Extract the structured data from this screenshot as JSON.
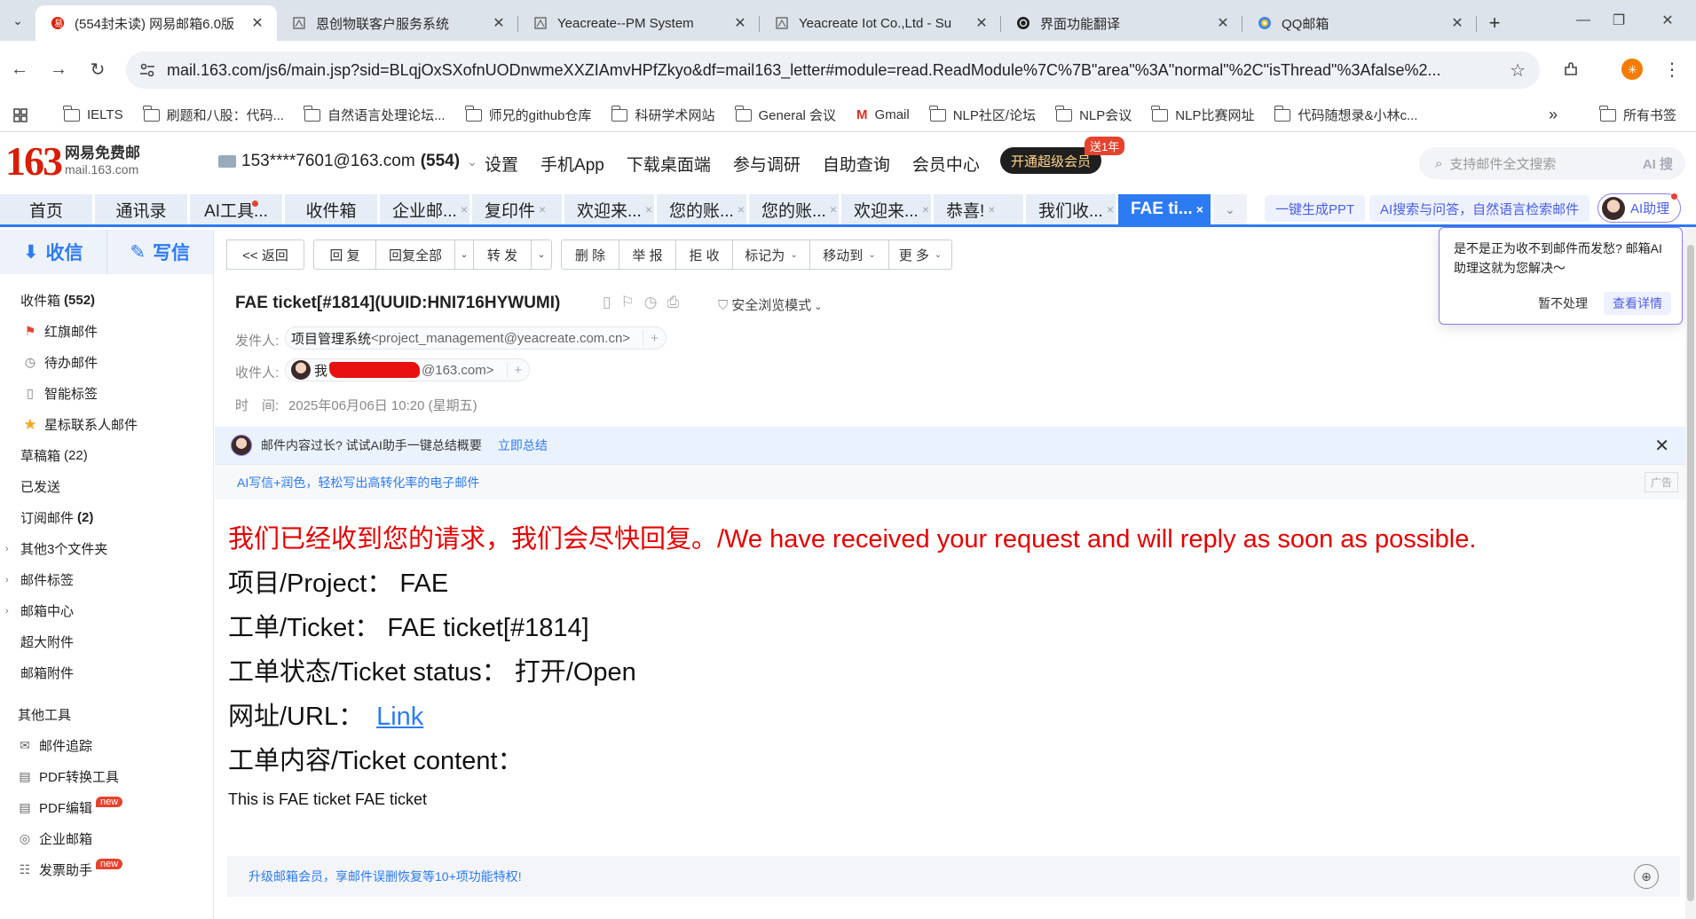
{
  "browser": {
    "tabs": [
      {
        "title": "(554封未读) 网易邮箱6.0版",
        "icon": "netease-mail-icon",
        "active": true
      },
      {
        "title": "恩创物联客户服务系统",
        "icon": "page-icon",
        "active": false
      },
      {
        "title": "Yeacreate--PM System",
        "icon": "page-icon",
        "active": false
      },
      {
        "title": "Yeacreate Iot Co.,Ltd - Su",
        "icon": "page-icon",
        "active": false
      },
      {
        "title": "界面功能翻译",
        "icon": "openai-icon",
        "active": false
      },
      {
        "title": "QQ邮箱",
        "icon": "qq-mail-icon",
        "active": false
      }
    ],
    "url": "mail.163.com/js6/main.jsp?sid=BLqjOxSXofnUODnwmeXXZIAmvHPfZkyo&df=mail163_letter#module=read.ReadModule%7C%7B\"area\"%3A\"normal\"%2C\"isThread\"%3Afalse%2...",
    "bookmarks": [
      "IELTS",
      "刷题和八股：代码...",
      "自然语言处理论坛...",
      "师兄的github仓库",
      "科研学术网站",
      "General 会议",
      "Gmail",
      "NLP社区/论坛",
      "NLP会议",
      "NLP比赛网址",
      "代码随想录&小林c..."
    ],
    "all_bookmarks": "所有书签"
  },
  "app": {
    "logo_num": "163",
    "logo_title": "网易免费邮",
    "logo_sub": "mail.163.com",
    "account": "153****7601@163.com",
    "unread": "(554)",
    "nav": [
      "设置",
      "手机App",
      "下载桌面端",
      "参与调研",
      "自助查询",
      "会员中心"
    ],
    "vip": "开通超级会员",
    "vip_badge": "送1年",
    "search_placeholder": "支持邮件全文搜索",
    "search_ai": "AI 搜"
  },
  "module_tabs": [
    {
      "label": "首页",
      "close": ""
    },
    {
      "label": "通讯录",
      "close": ""
    },
    {
      "label": "AI工具...",
      "close": ""
    },
    {
      "label": "收件箱",
      "close": ""
    },
    {
      "label": "企业邮...",
      "close": "×"
    },
    {
      "label": "复印件",
      "close": "×"
    },
    {
      "label": "欢迎来...",
      "close": "×"
    },
    {
      "label": "您的账...",
      "close": "×"
    },
    {
      "label": "您的账...",
      "close": "×"
    },
    {
      "label": "欢迎来...",
      "close": "×"
    },
    {
      "label": "恭喜!",
      "close": "×"
    },
    {
      "label": "我们收...",
      "close": "×"
    },
    {
      "label": "FAE ti...",
      "close": "×"
    }
  ],
  "ai_tools": {
    "ppt": "一键生成PPT",
    "search": "AI搜索与问答，自然语言检索邮件",
    "assistant": "AI助理"
  },
  "sidebar": {
    "receive": "收信",
    "compose": "写信",
    "folders": [
      {
        "label": "收件箱",
        "count": "(552)",
        "icon": "",
        "arrow": ""
      },
      {
        "label": "红旗邮件",
        "count": "",
        "icon": "flag-icon",
        "arrow": ""
      },
      {
        "label": "待办邮件",
        "count": "",
        "icon": "clock-icon",
        "arrow": ""
      },
      {
        "label": "智能标签",
        "count": "",
        "icon": "tag-icon",
        "arrow": ""
      },
      {
        "label": "星标联系人邮件",
        "count": "",
        "icon": "star-icon",
        "arrow": ""
      },
      {
        "label": "草稿箱",
        "count": "(22)",
        "icon": "",
        "arrow": ""
      },
      {
        "label": "已发送",
        "count": "",
        "icon": "",
        "arrow": ""
      },
      {
        "label": "订阅邮件",
        "count": "(2)",
        "icon": "",
        "arrow": ""
      },
      {
        "label": "其他3个文件夹",
        "count": "",
        "icon": "",
        "arrow": "›"
      },
      {
        "label": "邮件标签",
        "count": "",
        "icon": "",
        "arrow": "›"
      },
      {
        "label": "邮箱中心",
        "count": "",
        "icon": "",
        "arrow": "›"
      },
      {
        "label": "超大附件",
        "count": "",
        "icon": "",
        "arrow": ""
      },
      {
        "label": "邮箱附件",
        "count": "",
        "icon": "",
        "arrow": ""
      }
    ],
    "tools_title": "其他工具",
    "tools": [
      {
        "label": "邮件追踪",
        "icon": "tracking-icon",
        "badge": ""
      },
      {
        "label": "PDF转换工具",
        "icon": "pdf-icon",
        "badge": ""
      },
      {
        "label": "PDF编辑",
        "icon": "pdf-edit-icon",
        "badge": "new"
      },
      {
        "label": "企业邮箱",
        "icon": "globe-icon",
        "badge": ""
      },
      {
        "label": "发票助手",
        "icon": "invoice-icon",
        "badge": "new"
      }
    ]
  },
  "toolbar": {
    "back": "<< 返回",
    "reply": "回 复",
    "reply_all": "回复全部",
    "forward": "转 发",
    "delete": "删 除",
    "report": "举 报",
    "reject": "拒 收",
    "mark": "标记为",
    "move": "移动到",
    "more": "更 多"
  },
  "mail": {
    "subject": "FAE ticket[#1814](UUID:HNI716HYWUMI)",
    "safe_mode": "安全浏览模式",
    "from_label": "发件人:",
    "from_name": "项目管理系统",
    "from_email": "<project_management@yeacreate.com.cn>",
    "to_label": "收件人:",
    "to_name": "我",
    "to_email": "@163.com>",
    "time_label": "时　间:",
    "time": "2025年06月06日 10:20 (星期五)",
    "ai_summary_text": "邮件内容过长? 试试AI助手一键总结概要",
    "ai_summary_link": "立即总结",
    "ad_text": "AI写信+润色，轻松写出高转化率的电子邮件",
    "ad_badge": "广告",
    "body": {
      "ack": "我们已经收到您的请求，我们会尽快回复。/We have received your request and will reply as soon as possible.",
      "project": "项目/Project： FAE",
      "ticket": "工单/Ticket： FAE ticket[#1814]",
      "status": "工单状态/Ticket status： 打开/Open",
      "url_label": "网址/URL：",
      "url_link": "Link",
      "content_label": "工单内容/Ticket content：",
      "content": "This is FAE ticket FAE ticket"
    },
    "footer": "升级邮箱会员，享邮件误删恢复等10+项功能特权!"
  },
  "popover": {
    "text": "是不是正为收不到邮件而发愁? 邮箱AI助理这就为您解决～",
    "later": "暂不处理",
    "detail": "查看详情"
  },
  "colors": {
    "brand_red": "#d81e06",
    "accent_blue": "#2d7bf3",
    "alert_red": "#e60000",
    "ai_purple": "#8e7cf0"
  }
}
